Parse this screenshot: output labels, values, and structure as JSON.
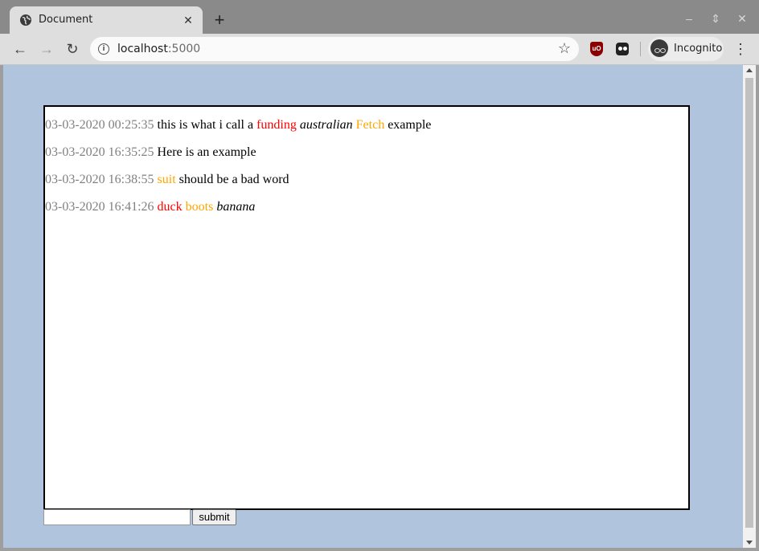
{
  "browser": {
    "tab_title": "Document",
    "tab_icon": "globe-icon",
    "new_tab": "+",
    "close_tab": "✕",
    "url_host": "localhost",
    "url_port": ":5000",
    "incognito_label": "Incognito",
    "window_controls": [
      "minimize",
      "maximize",
      "close"
    ]
  },
  "colors": {
    "page_background": "#b0c4de",
    "timestamp": "#808080",
    "bad_word": "#ff0000",
    "warn_word": "#ffa500"
  },
  "messages": [
    {
      "timestamp": "03-03-2020 00:25:35",
      "parts": [
        {
          "text": "this is what i call a ",
          "style": "plain"
        },
        {
          "text": "funding",
          "style": "red"
        },
        {
          "text": " ",
          "style": "plain"
        },
        {
          "text": "australian",
          "style": "italic"
        },
        {
          "text": " ",
          "style": "plain"
        },
        {
          "text": "Fetch",
          "style": "orange"
        },
        {
          "text": " example",
          "style": "plain"
        }
      ]
    },
    {
      "timestamp": "03-03-2020 16:35:25",
      "parts": [
        {
          "text": "Here is an example",
          "style": "plain"
        }
      ]
    },
    {
      "timestamp": "03-03-2020 16:38:55",
      "parts": [
        {
          "text": "suit",
          "style": "orange"
        },
        {
          "text": " should be a bad word",
          "style": "plain"
        }
      ]
    },
    {
      "timestamp": "03-03-2020 16:41:26",
      "parts": [
        {
          "text": "duck",
          "style": "red"
        },
        {
          "text": " ",
          "style": "plain"
        },
        {
          "text": "boots",
          "style": "orange"
        },
        {
          "text": " ",
          "style": "plain"
        },
        {
          "text": "banana",
          "style": "italic"
        }
      ]
    }
  ],
  "form": {
    "input_value": "",
    "submit_label": "submit"
  }
}
